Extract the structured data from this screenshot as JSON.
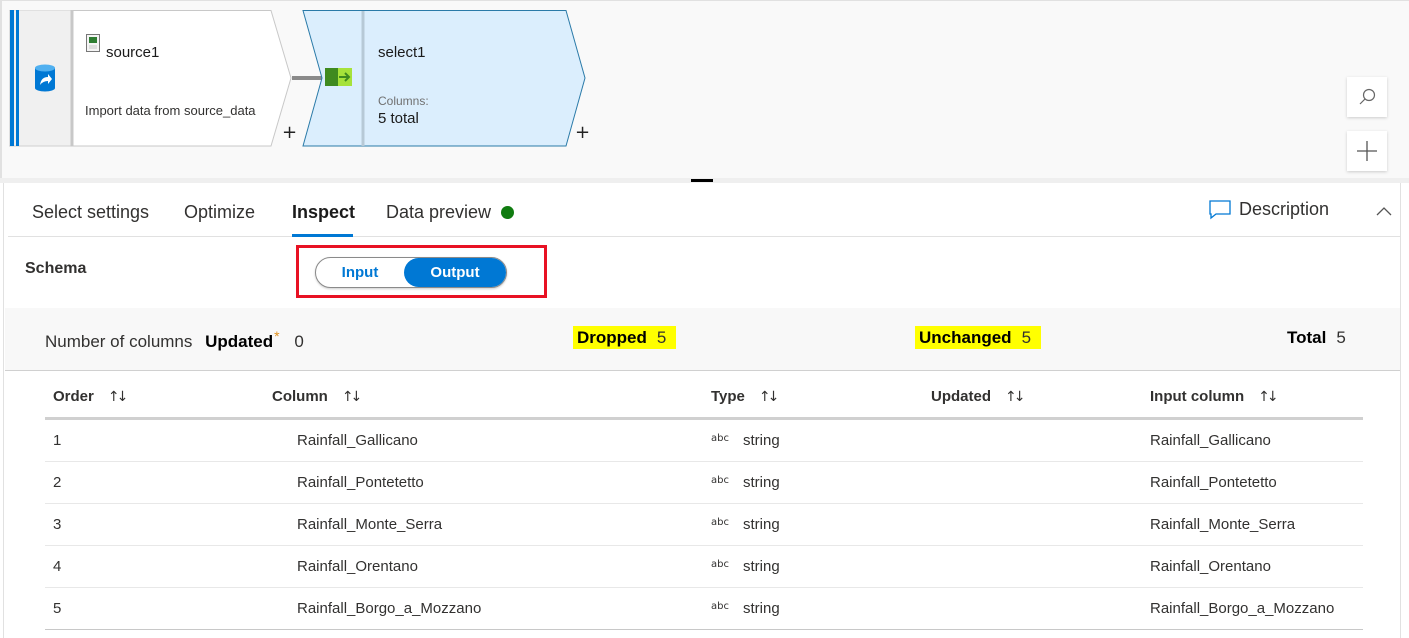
{
  "canvas": {
    "source_node": {
      "title": "source1",
      "description": "Import data from source_data",
      "icon": "database-import-icon",
      "file_icon": "csv-file-icon",
      "add_label": "+"
    },
    "select_node": {
      "title": "select1",
      "columns_label": "Columns:",
      "columns_value": "5 total",
      "icon": "select-transform-icon",
      "add_label": "+"
    },
    "tools": {
      "search_icon": "search-icon",
      "zoom_in_icon": "plus-icon"
    }
  },
  "tabs": {
    "items": [
      {
        "label": "Select settings",
        "active": false
      },
      {
        "label": "Optimize",
        "active": false
      },
      {
        "label": "Inspect",
        "active": true
      },
      {
        "label": "Data preview",
        "active": false
      }
    ],
    "status_color": "#107c10",
    "description_label": "Description"
  },
  "schema": {
    "label": "Schema",
    "toggle": {
      "input_label": "Input",
      "output_label": "Output",
      "selected": "Output"
    }
  },
  "summary": {
    "label": "Number of columns",
    "updated_label": "Updated",
    "updated_mark": "*",
    "updated_value": "0",
    "dropped_label": "Dropped",
    "dropped_value": "5",
    "unchanged_label": "Unchanged",
    "unchanged_value": "5",
    "total_label": "Total",
    "total_value": "5",
    "highlight_color": "#ffff00"
  },
  "table": {
    "headers": [
      "Order",
      "Column",
      "Type",
      "Updated",
      "Input column"
    ],
    "sort_glyph": "↑↓",
    "type_glyph": "abc",
    "rows": [
      {
        "order": "1",
        "column": "Rainfall_Gallicano",
        "type": "string",
        "updated": "",
        "input_column": "Rainfall_Gallicano"
      },
      {
        "order": "2",
        "column": "Rainfall_Pontetetto",
        "type": "string",
        "updated": "",
        "input_column": "Rainfall_Pontetetto"
      },
      {
        "order": "3",
        "column": "Rainfall_Monte_Serra",
        "type": "string",
        "updated": "",
        "input_column": "Rainfall_Monte_Serra"
      },
      {
        "order": "4",
        "column": "Rainfall_Orentano",
        "type": "string",
        "updated": "",
        "input_column": "Rainfall_Orentano"
      },
      {
        "order": "5",
        "column": "Rainfall_Borgo_a_Mozzano",
        "type": "string",
        "updated": "",
        "input_column": "Rainfall_Borgo_a_Mozzano"
      }
    ]
  },
  "colors": {
    "accent": "#0078d4",
    "highlight_box": "#e81123",
    "node_fill": "#dbeefd"
  }
}
